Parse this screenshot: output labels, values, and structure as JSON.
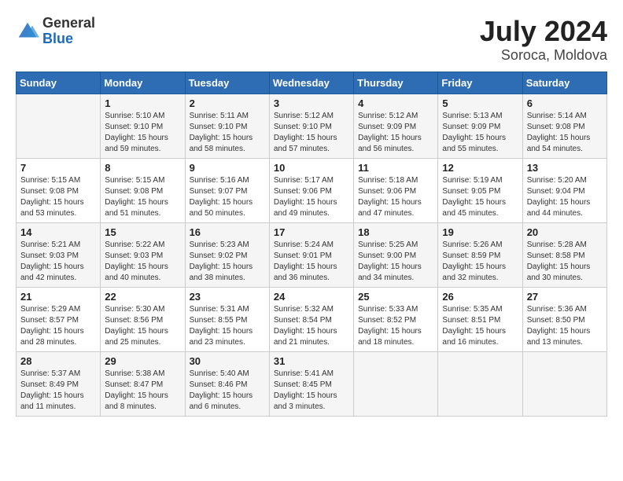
{
  "header": {
    "logo_general": "General",
    "logo_blue": "Blue",
    "month_year": "July 2024",
    "location": "Soroca, Moldova"
  },
  "weekdays": [
    "Sunday",
    "Monday",
    "Tuesday",
    "Wednesday",
    "Thursday",
    "Friday",
    "Saturday"
  ],
  "weeks": [
    [
      {
        "day": "",
        "sunrise": "",
        "sunset": "",
        "daylight": ""
      },
      {
        "day": "1",
        "sunrise": "Sunrise: 5:10 AM",
        "sunset": "Sunset: 9:10 PM",
        "daylight": "Daylight: 15 hours and 59 minutes."
      },
      {
        "day": "2",
        "sunrise": "Sunrise: 5:11 AM",
        "sunset": "Sunset: 9:10 PM",
        "daylight": "Daylight: 15 hours and 58 minutes."
      },
      {
        "day": "3",
        "sunrise": "Sunrise: 5:12 AM",
        "sunset": "Sunset: 9:10 PM",
        "daylight": "Daylight: 15 hours and 57 minutes."
      },
      {
        "day": "4",
        "sunrise": "Sunrise: 5:12 AM",
        "sunset": "Sunset: 9:09 PM",
        "daylight": "Daylight: 15 hours and 56 minutes."
      },
      {
        "day": "5",
        "sunrise": "Sunrise: 5:13 AM",
        "sunset": "Sunset: 9:09 PM",
        "daylight": "Daylight: 15 hours and 55 minutes."
      },
      {
        "day": "6",
        "sunrise": "Sunrise: 5:14 AM",
        "sunset": "Sunset: 9:08 PM",
        "daylight": "Daylight: 15 hours and 54 minutes."
      }
    ],
    [
      {
        "day": "7",
        "sunrise": "Sunrise: 5:15 AM",
        "sunset": "Sunset: 9:08 PM",
        "daylight": "Daylight: 15 hours and 53 minutes."
      },
      {
        "day": "8",
        "sunrise": "Sunrise: 5:15 AM",
        "sunset": "Sunset: 9:08 PM",
        "daylight": "Daylight: 15 hours and 51 minutes."
      },
      {
        "day": "9",
        "sunrise": "Sunrise: 5:16 AM",
        "sunset": "Sunset: 9:07 PM",
        "daylight": "Daylight: 15 hours and 50 minutes."
      },
      {
        "day": "10",
        "sunrise": "Sunrise: 5:17 AM",
        "sunset": "Sunset: 9:06 PM",
        "daylight": "Daylight: 15 hours and 49 minutes."
      },
      {
        "day": "11",
        "sunrise": "Sunrise: 5:18 AM",
        "sunset": "Sunset: 9:06 PM",
        "daylight": "Daylight: 15 hours and 47 minutes."
      },
      {
        "day": "12",
        "sunrise": "Sunrise: 5:19 AM",
        "sunset": "Sunset: 9:05 PM",
        "daylight": "Daylight: 15 hours and 45 minutes."
      },
      {
        "day": "13",
        "sunrise": "Sunrise: 5:20 AM",
        "sunset": "Sunset: 9:04 PM",
        "daylight": "Daylight: 15 hours and 44 minutes."
      }
    ],
    [
      {
        "day": "14",
        "sunrise": "Sunrise: 5:21 AM",
        "sunset": "Sunset: 9:03 PM",
        "daylight": "Daylight: 15 hours and 42 minutes."
      },
      {
        "day": "15",
        "sunrise": "Sunrise: 5:22 AM",
        "sunset": "Sunset: 9:03 PM",
        "daylight": "Daylight: 15 hours and 40 minutes."
      },
      {
        "day": "16",
        "sunrise": "Sunrise: 5:23 AM",
        "sunset": "Sunset: 9:02 PM",
        "daylight": "Daylight: 15 hours and 38 minutes."
      },
      {
        "day": "17",
        "sunrise": "Sunrise: 5:24 AM",
        "sunset": "Sunset: 9:01 PM",
        "daylight": "Daylight: 15 hours and 36 minutes."
      },
      {
        "day": "18",
        "sunrise": "Sunrise: 5:25 AM",
        "sunset": "Sunset: 9:00 PM",
        "daylight": "Daylight: 15 hours and 34 minutes."
      },
      {
        "day": "19",
        "sunrise": "Sunrise: 5:26 AM",
        "sunset": "Sunset: 8:59 PM",
        "daylight": "Daylight: 15 hours and 32 minutes."
      },
      {
        "day": "20",
        "sunrise": "Sunrise: 5:28 AM",
        "sunset": "Sunset: 8:58 PM",
        "daylight": "Daylight: 15 hours and 30 minutes."
      }
    ],
    [
      {
        "day": "21",
        "sunrise": "Sunrise: 5:29 AM",
        "sunset": "Sunset: 8:57 PM",
        "daylight": "Daylight: 15 hours and 28 minutes."
      },
      {
        "day": "22",
        "sunrise": "Sunrise: 5:30 AM",
        "sunset": "Sunset: 8:56 PM",
        "daylight": "Daylight: 15 hours and 25 minutes."
      },
      {
        "day": "23",
        "sunrise": "Sunrise: 5:31 AM",
        "sunset": "Sunset: 8:55 PM",
        "daylight": "Daylight: 15 hours and 23 minutes."
      },
      {
        "day": "24",
        "sunrise": "Sunrise: 5:32 AM",
        "sunset": "Sunset: 8:54 PM",
        "daylight": "Daylight: 15 hours and 21 minutes."
      },
      {
        "day": "25",
        "sunrise": "Sunrise: 5:33 AM",
        "sunset": "Sunset: 8:52 PM",
        "daylight": "Daylight: 15 hours and 18 minutes."
      },
      {
        "day": "26",
        "sunrise": "Sunrise: 5:35 AM",
        "sunset": "Sunset: 8:51 PM",
        "daylight": "Daylight: 15 hours and 16 minutes."
      },
      {
        "day": "27",
        "sunrise": "Sunrise: 5:36 AM",
        "sunset": "Sunset: 8:50 PM",
        "daylight": "Daylight: 15 hours and 13 minutes."
      }
    ],
    [
      {
        "day": "28",
        "sunrise": "Sunrise: 5:37 AM",
        "sunset": "Sunset: 8:49 PM",
        "daylight": "Daylight: 15 hours and 11 minutes."
      },
      {
        "day": "29",
        "sunrise": "Sunrise: 5:38 AM",
        "sunset": "Sunset: 8:47 PM",
        "daylight": "Daylight: 15 hours and 8 minutes."
      },
      {
        "day": "30",
        "sunrise": "Sunrise: 5:40 AM",
        "sunset": "Sunset: 8:46 PM",
        "daylight": "Daylight: 15 hours and 6 minutes."
      },
      {
        "day": "31",
        "sunrise": "Sunrise: 5:41 AM",
        "sunset": "Sunset: 8:45 PM",
        "daylight": "Daylight: 15 hours and 3 minutes."
      },
      {
        "day": "",
        "sunrise": "",
        "sunset": "",
        "daylight": ""
      },
      {
        "day": "",
        "sunrise": "",
        "sunset": "",
        "daylight": ""
      },
      {
        "day": "",
        "sunrise": "",
        "sunset": "",
        "daylight": ""
      }
    ]
  ]
}
